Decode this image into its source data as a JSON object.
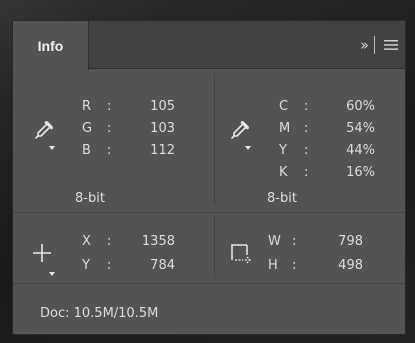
{
  "tab": {
    "label": "Info"
  },
  "rgb": {
    "channels": [
      {
        "label": "R",
        "sep": ":",
        "value": "105"
      },
      {
        "label": "G",
        "sep": ":",
        "value": "103"
      },
      {
        "label": "B",
        "sep": ":",
        "value": "112"
      }
    ],
    "bit_depth": "8-bit"
  },
  "cmyk": {
    "channels": [
      {
        "label": "C",
        "sep": ":",
        "value": "60%"
      },
      {
        "label": "M",
        "sep": ":",
        "value": "54%"
      },
      {
        "label": "Y",
        "sep": ":",
        "value": "44%"
      },
      {
        "label": "K",
        "sep": ":",
        "value": "16%"
      }
    ],
    "bit_depth": "8-bit"
  },
  "position": {
    "x": {
      "label": "X",
      "sep": ":",
      "value": "1358"
    },
    "y": {
      "label": "Y",
      "sep": ":",
      "value": "784"
    }
  },
  "size": {
    "w": {
      "label": "W",
      "sep": ":",
      "value": "798"
    },
    "h": {
      "label": "H",
      "sep": ":",
      "value": "498"
    }
  },
  "doc": {
    "text": "Doc: 10.5M/10.5M"
  },
  "icons": {
    "eyedropper": "eyedropper-icon",
    "crosshair": "crosshair-icon",
    "selection_size": "selection-size-icon",
    "collapse": "double-chevron-right-icon",
    "menu": "hamburger-menu-icon"
  }
}
